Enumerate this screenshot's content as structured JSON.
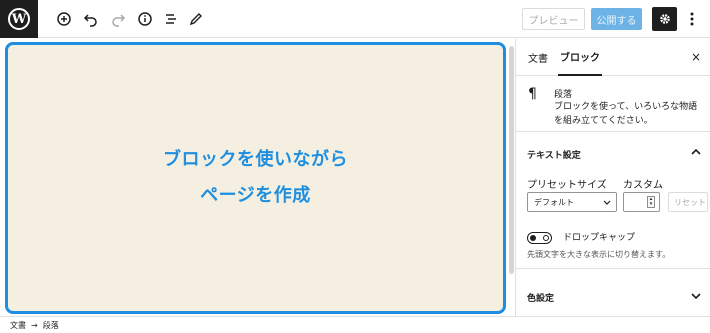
{
  "toolbar": {
    "preview_label": "プレビュー",
    "publish_label": "公開する"
  },
  "canvas": {
    "line1": "ブロックを使いながら",
    "line2": "ページを作成",
    "text_color": "#1e8fe0",
    "background_color": "#f5efe1"
  },
  "sidebar": {
    "tab_document": "文書",
    "tab_block": "ブロック",
    "close_symbol": "×",
    "block": {
      "icon_glyph": "¶",
      "title": "段落",
      "description": "ブロックを使って、いろいろな物語を組み立ててください。"
    },
    "text_settings": {
      "title": "テキスト設定",
      "preset_label": "プリセットサイズ",
      "preset_value": "デフォルト",
      "custom_label": "カスタム",
      "reset_label": "リセット",
      "drop_cap_label": "ドロップキャップ",
      "drop_cap_help": "先頭文字を大きな表示に切り替えます。"
    },
    "color_settings": {
      "title": "色設定"
    }
  },
  "breadcrumb": {
    "root": "文書",
    "separator": "→",
    "current": "段落"
  },
  "icons": [
    "wordpress-logo-icon",
    "add-block-icon",
    "undo-icon",
    "redo-icon",
    "info-icon",
    "list-view-icon",
    "edit-icon",
    "gear-icon",
    "more-options-icon",
    "paragraph-icon",
    "chevron-up-icon",
    "chevron-down-icon"
  ]
}
